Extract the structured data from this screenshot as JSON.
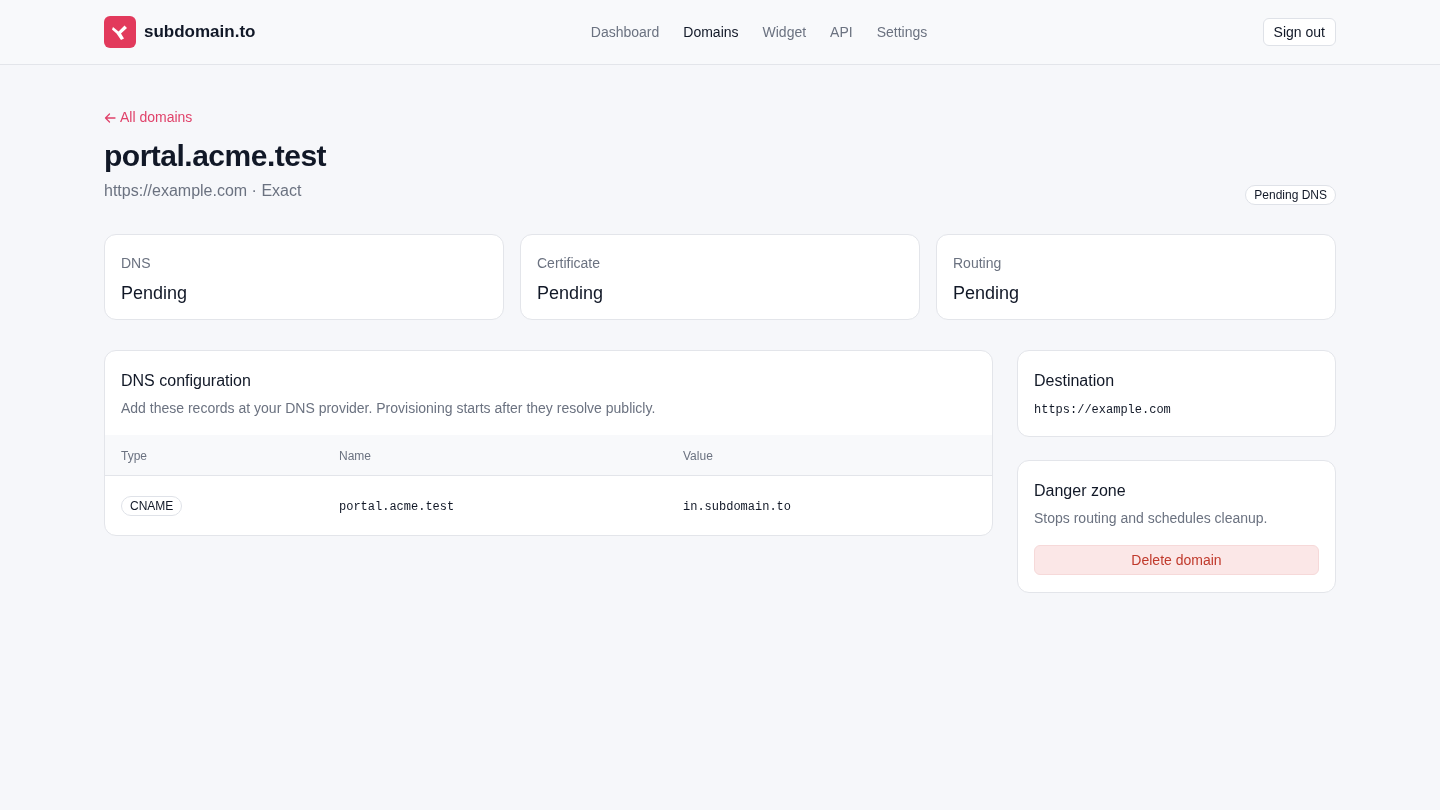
{
  "header": {
    "brand": "subdomain.to",
    "nav": [
      {
        "label": "Dashboard",
        "selected": false
      },
      {
        "label": "Domains",
        "selected": true
      },
      {
        "label": "Widget",
        "selected": false
      },
      {
        "label": "API",
        "selected": false
      },
      {
        "label": "Settings",
        "selected": false
      }
    ],
    "sign_out": "Sign out"
  },
  "back_link": "All domains",
  "title": "portal.acme.test",
  "subtitle": "https://example.com · Exact",
  "status_badge": "Pending DNS",
  "status_cards": [
    {
      "label": "DNS",
      "value": "Pending"
    },
    {
      "label": "Certificate",
      "value": "Pending"
    },
    {
      "label": "Routing",
      "value": "Pending"
    }
  ],
  "dns_configuration": {
    "title": "DNS configuration",
    "description": "Add these records at your DNS provider. Provisioning starts after they resolve publicly.",
    "columns": [
      "Type",
      "Name",
      "Value"
    ],
    "rows": [
      {
        "type": "CNAME",
        "name": "portal.acme.test",
        "value": "in.subdomain.to"
      }
    ]
  },
  "destination": {
    "title": "Destination",
    "url": "https://example.com"
  },
  "danger_zone": {
    "title": "Danger zone",
    "description": "Stops routing and schedules cleanup.",
    "button": "Delete domain"
  }
}
